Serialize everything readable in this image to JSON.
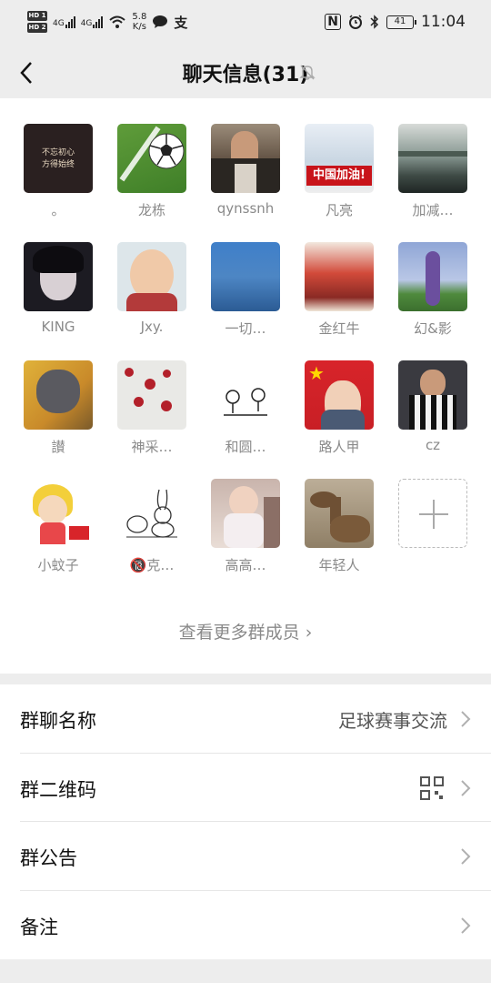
{
  "status_bar": {
    "hd1": "HD 1",
    "hd2": "HD 2",
    "net1": "4G",
    "net2": "4G",
    "speed_value": "5.8",
    "speed_unit": "K/s",
    "alipay_glyph": "支",
    "nfc_glyph": "N",
    "battery": "41",
    "time": "11:04"
  },
  "nav": {
    "title": "聊天信息(31)"
  },
  "members": [
    {
      "name": "。",
      "avatar_text": "不忘初心\n方得始终"
    },
    {
      "name": "龙栋",
      "avatar_text": ""
    },
    {
      "name": "qynssnh",
      "avatar_text": ""
    },
    {
      "name": "凡亮",
      "avatar_text": "中国加油!"
    },
    {
      "name": "加减…",
      "avatar_text": ""
    },
    {
      "name": "KING",
      "avatar_text": ""
    },
    {
      "name": "Jxy.",
      "avatar_text": ""
    },
    {
      "name": "一切…",
      "avatar_text": ""
    },
    {
      "name": "金红牛",
      "avatar_text": ""
    },
    {
      "name": "幻&影",
      "avatar_text": ""
    },
    {
      "name": "讃",
      "avatar_text": ""
    },
    {
      "name": "神采…",
      "avatar_text": ""
    },
    {
      "name": "和圆…",
      "avatar_text": ""
    },
    {
      "name": "路人甲",
      "avatar_text": ""
    },
    {
      "name": "cz",
      "avatar_text": ""
    },
    {
      "name": "小蚊子",
      "avatar_text": ""
    },
    {
      "name": "🔞克…",
      "avatar_text": ""
    },
    {
      "name": "高高…",
      "avatar_text": ""
    },
    {
      "name": "年轻人",
      "avatar_text": ""
    }
  ],
  "see_more": "查看更多群成员 ›",
  "settings": {
    "group_name_label": "群聊名称",
    "group_name_value": "足球赛事交流",
    "qr_label": "群二维码",
    "notice_label": "群公告",
    "remark_label": "备注"
  },
  "icons": {
    "back": "chevron-left-icon",
    "mute": "bell-off-icon",
    "add": "plus-icon",
    "chevron": "chevron-right-icon",
    "qr": "qr-code-icon"
  }
}
